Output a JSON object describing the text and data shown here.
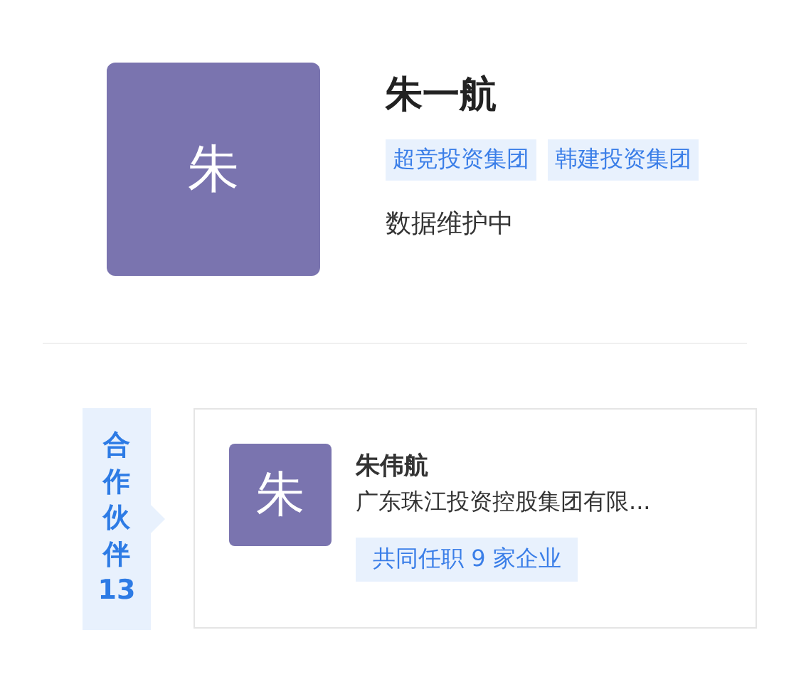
{
  "profile": {
    "avatar": "朱",
    "name": "朱一航",
    "tags": [
      "超竞投资集团",
      "韩建投资集团"
    ],
    "status": "数据维护中"
  },
  "partners": {
    "label": "合作伙伴",
    "count": "13",
    "cards": [
      {
        "avatar": "朱",
        "name": "朱伟航",
        "company": "广东珠江投资控股集团有限...",
        "badge": "共同任职 9 家企业"
      }
    ]
  }
}
